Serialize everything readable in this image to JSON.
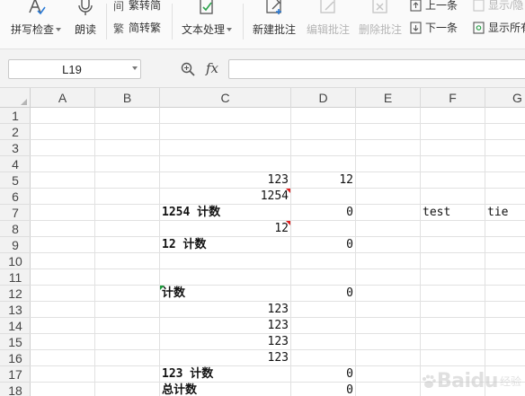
{
  "ribbon": {
    "spell_check": "拼写检查",
    "read_aloud": "朗读",
    "trad_to_simp": "繁转简",
    "simp_to_trad": "简转繁",
    "text_processing": "文本处理",
    "new_comment": "新建批注",
    "edit_comment": "编辑批注",
    "delete_comment": "删除批注",
    "prev_item": "上一条",
    "next_item": "下一条",
    "show_hide": "显示/隐",
    "show_all": "显示所有"
  },
  "formula_bar": {
    "name_box": "L19",
    "fx_label": "fx",
    "formula": ""
  },
  "columns": [
    "A",
    "B",
    "C",
    "D",
    "E",
    "F",
    "G"
  ],
  "rows": [
    "1",
    "2",
    "3",
    "4",
    "5",
    "6",
    "7",
    "8",
    "9",
    "10",
    "11",
    "12",
    "13",
    "14",
    "15",
    "16",
    "17",
    "18"
  ],
  "cells": {
    "C5": "123",
    "D5": "12",
    "C6": "1254",
    "C7": "1254 计数",
    "D7": "0",
    "F7": "test",
    "G7": "tie",
    "C8": "12",
    "C9": "12 计数",
    "D9": "0",
    "C12": " 计数",
    "D12": "0",
    "C13": "123",
    "C14": "123",
    "C15": "123",
    "C16": "123",
    "C17": "123 计数",
    "D17": "0",
    "C18": "总计数",
    "D18": "0"
  },
  "watermark": {
    "text": "Baidu",
    "sub": "经验"
  },
  "colors": {
    "comment_marker": "#e02020",
    "error_marker": "#1a9a3a",
    "header_bg": "#f2f2f2"
  }
}
